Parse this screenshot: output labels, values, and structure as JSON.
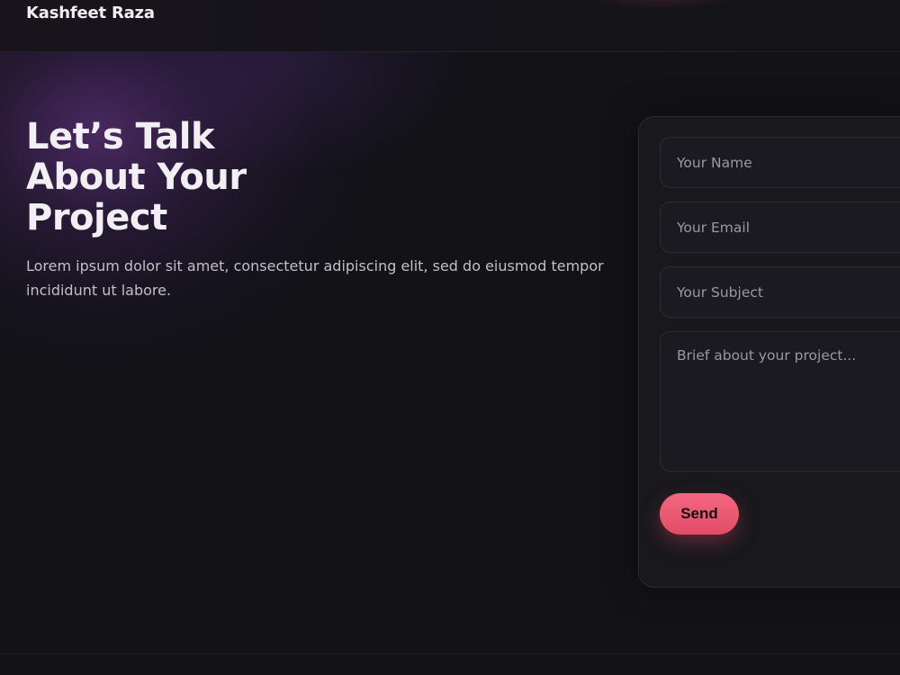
{
  "header": {
    "brand": "Kashfeet Raza"
  },
  "hero": {
    "headline_lines": [
      "Let’s Talk",
      "About Your",
      "Project"
    ],
    "description": "Lorem ipsum dolor sit amet, consectetur adipiscing elit, sed do eiusmod tempor incididunt ut labore."
  },
  "contact_form": {
    "name_placeholder": "Your Name",
    "email_placeholder": "Your Email",
    "subject_placeholder": "Your Subject",
    "brief_placeholder": "Brief about your project...",
    "send_label": "Send"
  },
  "colors": {
    "background": "#121217",
    "accent": "#ef5d76",
    "card": "#18181d",
    "text_primary": "#f2eff4",
    "text_secondary": "#c3bec8"
  }
}
